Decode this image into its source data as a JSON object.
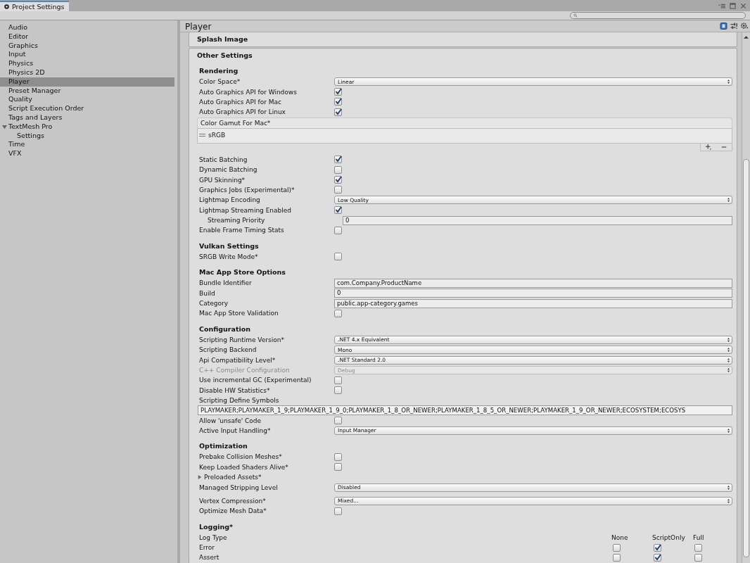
{
  "window": {
    "title": "Project Settings"
  },
  "sidebar": {
    "items": [
      {
        "label": "Audio",
        "selected": false
      },
      {
        "label": "Editor",
        "selected": false
      },
      {
        "label": "Graphics",
        "selected": false
      },
      {
        "label": "Input",
        "selected": false
      },
      {
        "label": "Physics",
        "selected": false
      },
      {
        "label": "Physics 2D",
        "selected": false
      },
      {
        "label": "Player",
        "selected": true
      },
      {
        "label": "Preset Manager",
        "selected": false
      },
      {
        "label": "Quality",
        "selected": false
      },
      {
        "label": "Script Execution Order",
        "selected": false
      },
      {
        "label": "Tags and Layers",
        "selected": false
      },
      {
        "label": "TextMesh Pro",
        "selected": false,
        "expanded": true,
        "children": [
          {
            "label": "Settings",
            "selected": false
          }
        ]
      },
      {
        "label": "Time",
        "selected": false
      },
      {
        "label": "VFX",
        "selected": false
      }
    ]
  },
  "inspector": {
    "title": "Player",
    "collapsed_section": "Splash Image",
    "section": "Other Settings",
    "groups": [
      {
        "title": "Rendering",
        "rows": [
          {
            "kind": "dropdown",
            "label": "Color Space*",
            "value": "Linear",
            "disabled": false
          },
          {
            "kind": "checkbox",
            "label": "Auto Graphics API  for Windows",
            "checked": true
          },
          {
            "kind": "checkbox",
            "label": "Auto Graphics API  for Mac",
            "checked": true
          },
          {
            "kind": "checkbox",
            "label": "Auto Graphics API  for Linux",
            "checked": true
          },
          {
            "kind": "list",
            "label": "Color Gamut For Mac*",
            "items": [
              "sRGB"
            ]
          }
        ]
      },
      {
        "rows": [
          {
            "kind": "checkbox",
            "label": "Static Batching",
            "checked": true
          },
          {
            "kind": "checkbox",
            "label": "Dynamic Batching",
            "checked": false
          },
          {
            "kind": "checkbox",
            "label": "GPU Skinning*",
            "checked": true
          },
          {
            "kind": "checkbox",
            "label": "Graphics Jobs (Experimental)*",
            "checked": false
          },
          {
            "kind": "dropdown",
            "label": "Lightmap Encoding",
            "value": "Low Quality",
            "disabled": false
          },
          {
            "kind": "checkbox",
            "label": "Lightmap Streaming Enabled",
            "checked": true,
            "children": [
              {
                "kind": "text",
                "label": "Streaming Priority",
                "value": "0"
              }
            ]
          },
          {
            "kind": "checkbox",
            "label": "Enable Frame Timing Stats",
            "checked": false
          }
        ]
      },
      {
        "title": "Vulkan Settings",
        "rows": [
          {
            "kind": "checkbox",
            "label": "SRGB Write Mode*",
            "checked": false
          }
        ]
      },
      {
        "title": "Mac App Store Options",
        "rows": [
          {
            "kind": "text",
            "label": "Bundle Identifier",
            "value": "com.Company.ProductName"
          },
          {
            "kind": "text",
            "label": "Build",
            "value": "0"
          },
          {
            "kind": "text",
            "label": "Category",
            "value": "public.app-category.games"
          },
          {
            "kind": "checkbox",
            "label": "Mac App Store Validation",
            "checked": false
          }
        ]
      },
      {
        "title": "Configuration",
        "rows": [
          {
            "kind": "dropdown",
            "label": "Scripting Runtime Version*",
            "value": ".NET 4.x Equivalent",
            "disabled": false
          },
          {
            "kind": "dropdown",
            "label": "Scripting Backend",
            "value": "Mono",
            "disabled": false
          },
          {
            "kind": "dropdown",
            "label": "Api Compatibility Level*",
            "value": ".NET Standard 2.0",
            "disabled": false
          },
          {
            "kind": "dropdown",
            "label": "C++ Compiler Configuration",
            "value": "Debug",
            "disabled": true
          },
          {
            "kind": "checkbox",
            "label": "Use incremental GC (Experimental)",
            "checked": false
          },
          {
            "kind": "checkbox",
            "label": "Disable HW Statistics*",
            "checked": false
          },
          {
            "kind": "widetext",
            "label": "Scripting Define Symbols",
            "value": "PLAYMAKER;PLAYMAKER_1_9;PLAYMAKER_1_9_0;PLAYMAKER_1_8_OR_NEWER;PLAYMAKER_1_8_5_OR_NEWER;PLAYMAKER_1_9_OR_NEWER;ECOSYSTEM;ECOSYS"
          },
          {
            "kind": "checkbox",
            "label": "Allow 'unsafe' Code",
            "checked": false
          },
          {
            "kind": "dropdown",
            "label": "Active Input Handling*",
            "value": "Input Manager",
            "disabled": false
          }
        ]
      },
      {
        "title": "Optimization",
        "rows": [
          {
            "kind": "checkbox",
            "label": "Prebake Collision Meshes*",
            "checked": false
          },
          {
            "kind": "checkbox",
            "label": "Keep Loaded Shaders Alive*",
            "checked": false
          },
          {
            "kind": "foldout",
            "label": "Preloaded Assets*",
            "expanded": false
          },
          {
            "kind": "dropdown",
            "label": "Managed Stripping Level",
            "value": "Disabled",
            "disabled": false
          }
        ]
      },
      {
        "rows": [
          {
            "kind": "dropdown",
            "label": "Vertex Compression*",
            "value": "Mixed...",
            "disabled": false
          },
          {
            "kind": "checkbox",
            "label": "Optimize Mesh Data*",
            "checked": false
          }
        ]
      }
    ],
    "logging": {
      "title": "Logging*",
      "header": "Log Type",
      "columns": [
        "None",
        "ScriptOnly",
        "Full"
      ],
      "rows": [
        {
          "label": "Error",
          "options": [
            {
              "checked": false
            },
            {
              "checked": true
            },
            {
              "checked": false
            }
          ]
        },
        {
          "label": "Assert",
          "options": [
            {
              "checked": false
            },
            {
              "checked": true
            },
            {
              "checked": false
            }
          ]
        }
      ]
    }
  }
}
